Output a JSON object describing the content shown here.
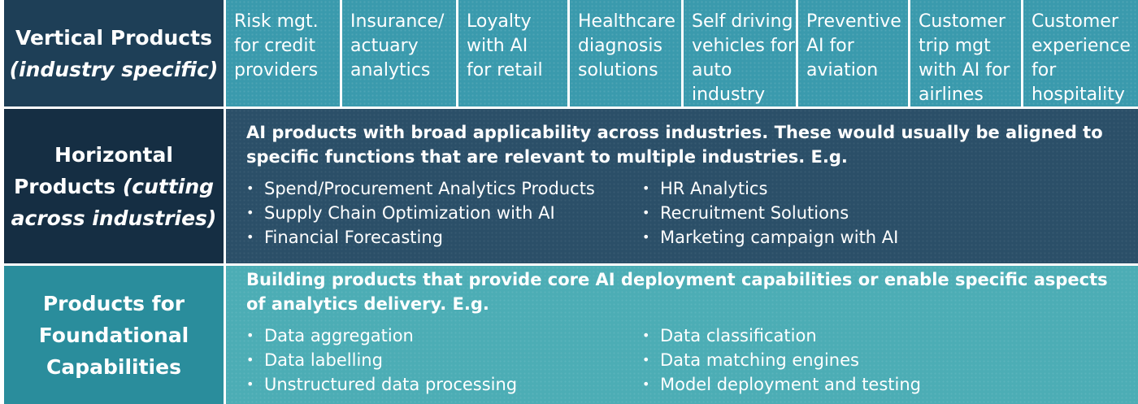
{
  "rows": {
    "vertical": {
      "label_main": "Vertical Products",
      "label_sub": "(industry specific)",
      "items": [
        "Risk mgt.\nfor credit\nproviders",
        "Insurance/\nactuary\nanalytics",
        "Loyalty\nwith AI\nfor retail",
        "Healthcare\ndiagnosis\nsolutions",
        "Self driving\nvehicles for\nauto\nindustry",
        "Preventive\nAI for\naviation",
        "Customer\ntrip mgt\nwith AI for\nairlines",
        "Customer\nexperience\nfor\nhospitality"
      ]
    },
    "horizontal": {
      "label_line1": "Horizontal",
      "label_line2": "Products",
      "label_line2_italic": "(cutting",
      "label_line3": "across industries)",
      "intro": "AI products with broad applicability across industries. These would usually be aligned to specific functions that are relevant to multiple industries. E.g.",
      "col1": [
        "Spend/Procurement Analytics Products",
        "Supply Chain Optimization with AI",
        "Financial Forecasting"
      ],
      "col2": [
        "HR Analytics",
        "Recruitment Solutions",
        "Marketing campaign with AI"
      ]
    },
    "foundational": {
      "label": "Products for\nFoundational\nCapabilities",
      "intro": "Building products that provide core AI deployment capabilities or enable specific aspects of analytics delivery. E.g.",
      "col1": [
        "Data aggregation",
        "Data labelling",
        "Unstructured data processing"
      ],
      "col2": [
        "Data classification",
        "Data matching engines",
        "Model deployment and testing"
      ]
    }
  },
  "bullet": "•",
  "colors": {
    "vertical_label_bg": "#1e3f57",
    "vertical_cell_bg": "#3a9aad",
    "horizontal_label_bg": "#152e43",
    "horizontal_panel_bg": "#2b4f68",
    "foundational_label_bg": "#2a8d9c",
    "foundational_panel_bg": "#4cadb5",
    "text": "#ffffff"
  }
}
